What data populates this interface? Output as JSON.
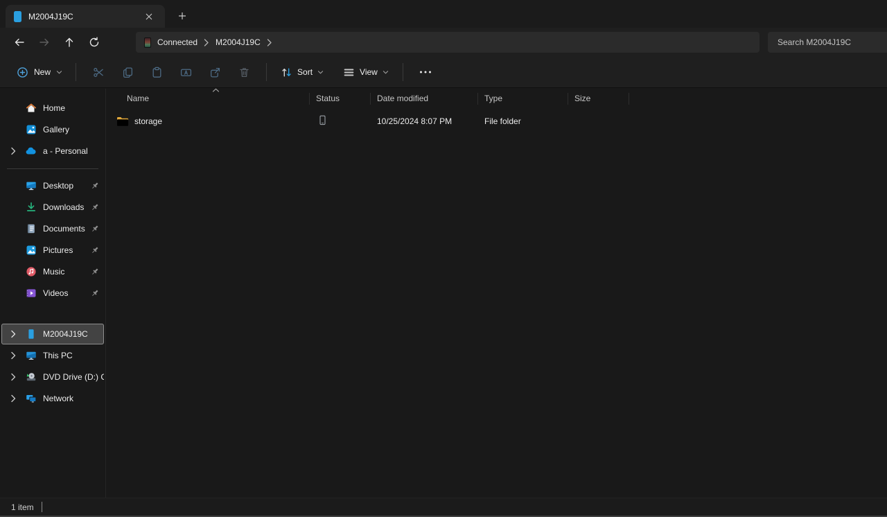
{
  "colors": {
    "accent_blue": "#2a9fe0",
    "folder_yellow": "#f7d05e",
    "window_bg": "#191919",
    "header_bg": "#1f1f1f",
    "selection_bg": "#434343"
  },
  "tab_bar": {
    "active_tab_title": "M2004J19C"
  },
  "address": {
    "breadcrumb_root": "Connected",
    "breadcrumb_current": "M2004J19C"
  },
  "search": {
    "placeholder": "Search M2004J19C"
  },
  "toolbar": {
    "new": "New",
    "sort": "Sort",
    "view": "View"
  },
  "table": {
    "columns": {
      "name": "Name",
      "status": "Status",
      "date_modified": "Date modified",
      "type": "Type",
      "size": "Size"
    },
    "rows": [
      {
        "name": "storage",
        "date_modified": "10/25/2024 8:07 PM",
        "type": "File folder",
        "size": ""
      }
    ]
  },
  "sidebar": {
    "top": [
      {
        "label": "Home"
      },
      {
        "label": "Gallery"
      },
      {
        "label": "a - Personal"
      }
    ],
    "pinned": [
      {
        "label": "Desktop"
      },
      {
        "label": "Downloads"
      },
      {
        "label": "Documents"
      },
      {
        "label": "Pictures"
      },
      {
        "label": "Music"
      },
      {
        "label": "Videos"
      }
    ],
    "tree": [
      {
        "label": "M2004J19C"
      },
      {
        "label": "This PC"
      },
      {
        "label": "DVD Drive (D:) CCC"
      },
      {
        "label": "Network"
      }
    ]
  },
  "status_bar": {
    "count": "1 item"
  }
}
